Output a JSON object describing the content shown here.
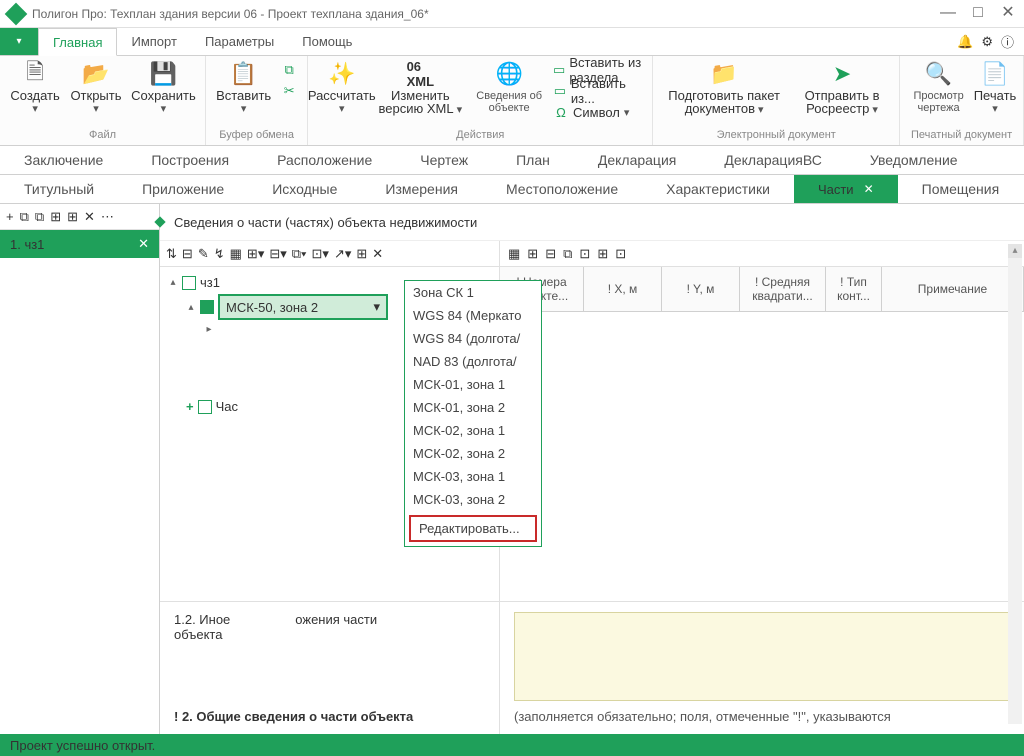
{
  "window": {
    "title": "Полигон Про: Техплан здания версии 06 - Проект техплана здания_06*"
  },
  "menu": {
    "tabs": [
      "Главная",
      "Импорт",
      "Параметры",
      "Помощь"
    ]
  },
  "ribbon": {
    "file": {
      "create": "Создать",
      "open": "Открыть",
      "save": "Сохранить",
      "caption": "Файл"
    },
    "clip": {
      "paste": "Вставить",
      "caption": "Буфер обмена"
    },
    "actions": {
      "calc": "Рассчитать",
      "xml": "Изменить версию XML",
      "info": "Сведения об объекте",
      "ins1": "Вставить из раздела",
      "ins2": "Вставить из...",
      "symbol": "Символ",
      "caption": "Действия",
      "xmlico": "06",
      "xmlico2": "XML"
    },
    "edoc": {
      "prep": "Подготовить пакет документов",
      "send": "Отправить в Росреестр",
      "caption": "Электронный документ"
    },
    "print": {
      "preview": "Просмотр чертежа",
      "print": "Печать",
      "caption": "Печатный документ"
    }
  },
  "sections": {
    "row1": [
      "Заключение",
      "Построения",
      "Расположение",
      "Чертеж",
      "План",
      "Декларация",
      "ДекларацияВС",
      "Уведомление"
    ],
    "row2": [
      "Титульный",
      "Приложение",
      "Исходные",
      "Измерения",
      "Местоположение",
      "Характеристики",
      "Части",
      "Помещения"
    ]
  },
  "left": {
    "item": "1.   чз1"
  },
  "main": {
    "heading": "Сведения о части (частях) объекта недвижимости",
    "tree": {
      "root": "чз1",
      "sel": "МСК-50, зона 2",
      "child": "Час"
    },
    "dropdown": [
      "Зона СК 1",
      "WGS 84 (Меркато",
      "WGS 84 (долгота/",
      "NAD 83 (долгота/",
      "МСК-01, зона 1",
      "МСК-01, зона 2",
      "МСК-02, зона 1",
      "МСК-02, зона 2",
      "МСК-03, зона 1",
      "МСК-03, зона 2"
    ],
    "ddedit": "Редактировать...",
    "grid": {
      "cols": [
        "! Номера характе...",
        "! X, м",
        "! Y, м",
        "! Средняя квадрати...",
        "! Тип конт...",
        "Примечание"
      ]
    },
    "bottomLeft1": "1.2. Иное",
    "bottomLeft2": "ожения части",
    "bottomLeft3": "объекта",
    "section2": "! 2. Общие сведения о части объекта",
    "hint": "(заполняется обязательно; поля, отмеченные \"!\", указываются"
  },
  "status": "Проект успешно открыт."
}
